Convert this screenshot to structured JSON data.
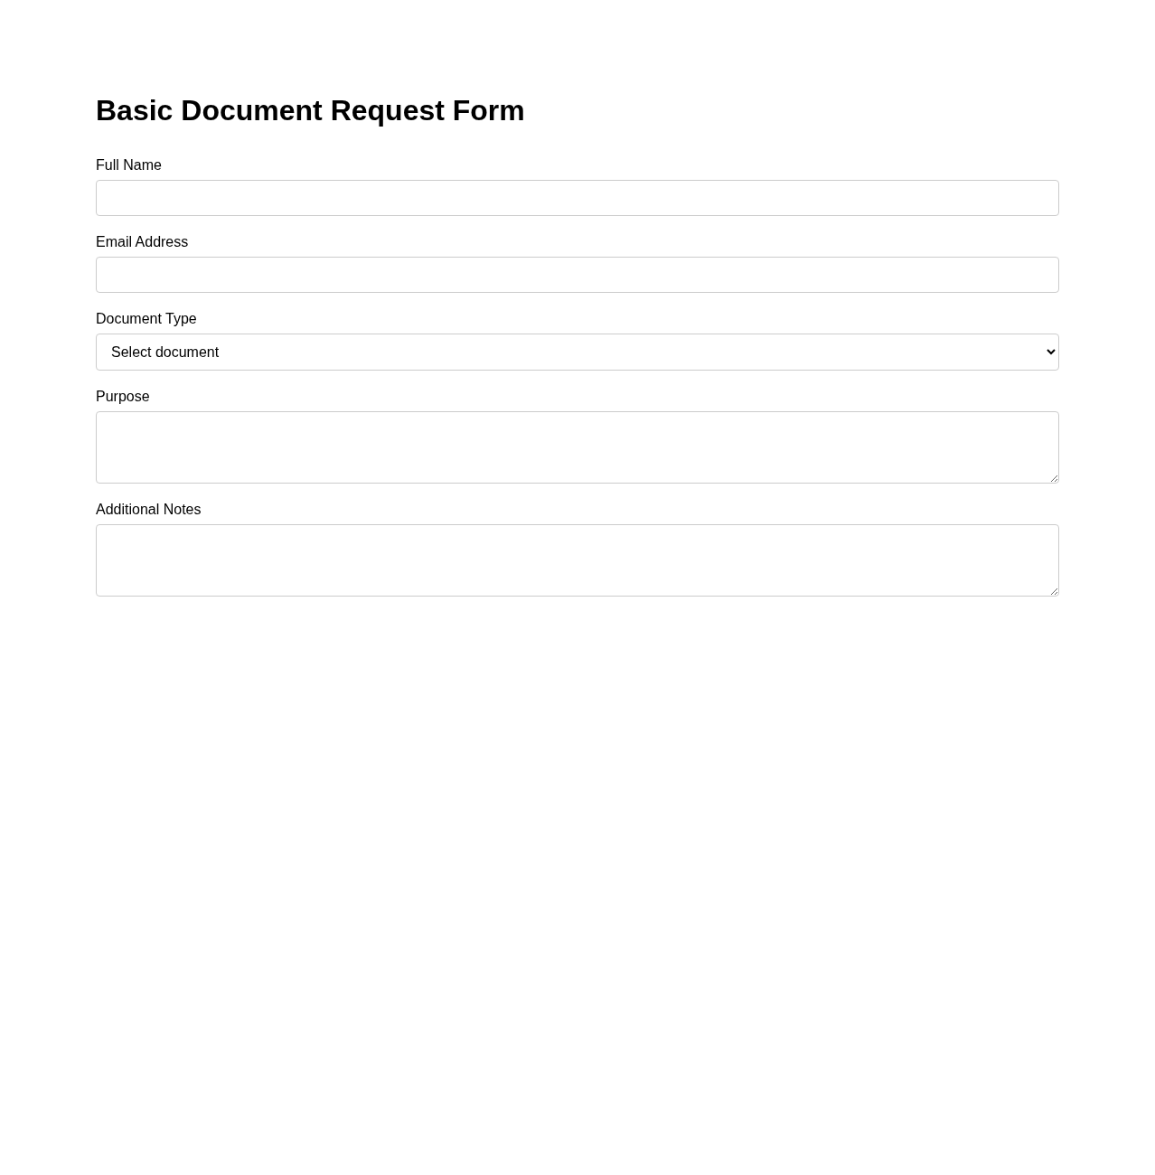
{
  "title": "Basic Document Request Form",
  "fields": [
    {
      "kind": "text",
      "label": "Full Name"
    },
    {
      "kind": "text",
      "label": "Email Address"
    },
    {
      "kind": "select",
      "label": "Document Type",
      "value": "Select document"
    },
    {
      "kind": "textarea",
      "label": "Purpose"
    },
    {
      "kind": "textarea",
      "label": "Additional Notes"
    }
  ]
}
